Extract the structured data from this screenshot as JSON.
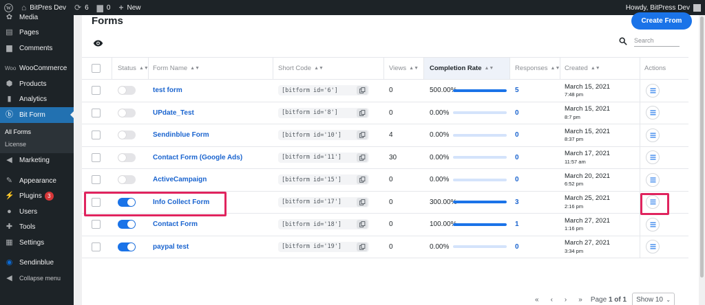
{
  "admin_bar": {
    "site_name": "BitPres Dev",
    "updates_count": "6",
    "comments_count": "0",
    "new_label": "New",
    "howdy": "Howdy, BitPress Dev"
  },
  "sidebar": {
    "items": [
      {
        "label": "Media",
        "icon": "media-icon"
      },
      {
        "label": "Pages",
        "icon": "pages-icon"
      },
      {
        "label": "Comments",
        "icon": "comments-icon"
      },
      {
        "label": "WooCommerce",
        "icon": "woocommerce-icon"
      },
      {
        "label": "Products",
        "icon": "products-icon"
      },
      {
        "label": "Analytics",
        "icon": "analytics-icon"
      },
      {
        "label": "Bit Form",
        "icon": "bitform-icon"
      },
      {
        "label": "Marketing",
        "icon": "marketing-icon"
      },
      {
        "label": "Appearance",
        "icon": "appearance-icon"
      },
      {
        "label": "Plugins",
        "icon": "plugins-icon",
        "badge": "3"
      },
      {
        "label": "Users",
        "icon": "users-icon"
      },
      {
        "label": "Tools",
        "icon": "tools-icon"
      },
      {
        "label": "Settings",
        "icon": "settings-icon"
      },
      {
        "label": "Sendinblue",
        "icon": "sendinblue-icon"
      },
      {
        "label": "Collapse menu",
        "icon": "collapse-icon"
      }
    ],
    "submenu": [
      "All Forms",
      "License"
    ]
  },
  "page": {
    "title": "Forms",
    "create_button": "Create From",
    "search_placeholder": "Search"
  },
  "table": {
    "headers": {
      "status": "Status",
      "form_name": "Form Name",
      "short_code": "Short Code",
      "views": "Views",
      "completion_rate": "Completion Rate",
      "responses": "Responses",
      "created": "Created",
      "actions": "Actions"
    },
    "rows": [
      {
        "enabled": false,
        "name": "test form",
        "shortcode": "[bitform id='6']",
        "views": "0",
        "rate": "500.00%",
        "rate_fill": 1.0,
        "responses": "5",
        "date": "March 15, 2021",
        "time": "7:48 pm"
      },
      {
        "enabled": false,
        "name": "UPdate_Test",
        "shortcode": "[bitform id='8']",
        "views": "0",
        "rate": "0.00%",
        "rate_fill": 0.0,
        "responses": "0",
        "date": "March 15, 2021",
        "time": "8:7 pm"
      },
      {
        "enabled": false,
        "name": "Sendinblue Form",
        "shortcode": "[bitform id='10']",
        "views": "4",
        "rate": "0.00%",
        "rate_fill": 0.0,
        "responses": "0",
        "date": "March 15, 2021",
        "time": "8:37 pm"
      },
      {
        "enabled": false,
        "name": "Contact Form (Google Ads)",
        "shortcode": "[bitform id='11']",
        "views": "30",
        "rate": "0.00%",
        "rate_fill": 0.0,
        "responses": "0",
        "date": "March 17, 2021",
        "time": "11:57 am"
      },
      {
        "enabled": false,
        "name": "ActiveCampaign",
        "shortcode": "[bitform id='15']",
        "views": "0",
        "rate": "0.00%",
        "rate_fill": 0.0,
        "responses": "0",
        "date": "March 20, 2021",
        "time": "6:52 pm"
      },
      {
        "enabled": true,
        "name": "Info Collect Form",
        "shortcode": "[bitform id='17']",
        "views": "0",
        "rate": "300.00%",
        "rate_fill": 1.0,
        "responses": "3",
        "date": "March 25, 2021",
        "time": "2:16 pm"
      },
      {
        "enabled": true,
        "name": "Contact Form",
        "shortcode": "[bitform id='18']",
        "views": "0",
        "rate": "100.00%",
        "rate_fill": 1.0,
        "responses": "1",
        "date": "March 27, 2021",
        "time": "1:16 pm"
      },
      {
        "enabled": true,
        "name": "paypal test",
        "shortcode": "[bitform id='19']",
        "views": "0",
        "rate": "0.00%",
        "rate_fill": 0.0,
        "responses": "0",
        "date": "March 27, 2021",
        "time": "3:34 pm"
      }
    ]
  },
  "pagination": {
    "first": "«",
    "prev": "‹",
    "next": "›",
    "last": "»",
    "page_label": "Page",
    "page_current": "1 of 1",
    "show_label": "Show 10"
  },
  "colors": {
    "accent": "#1a73e8",
    "highlight": "#e0245e",
    "sidebar_bg": "#1d2327",
    "active_menu": "#2271b1"
  }
}
